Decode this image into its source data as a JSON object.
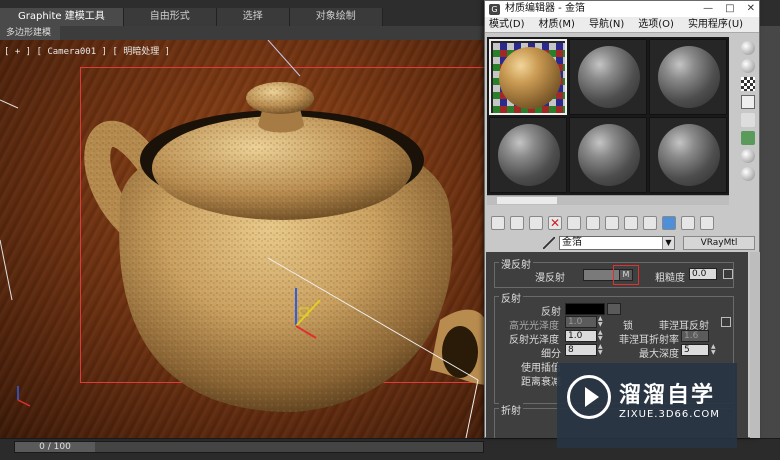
{
  "ribbon": {
    "tabs": [
      {
        "label": "Graphite 建模工具",
        "active": true
      },
      {
        "label": "自由形式",
        "active": false
      },
      {
        "label": "选择",
        "active": false
      },
      {
        "label": "对象绘制",
        "active": false
      }
    ],
    "sub_label": "多边形建模"
  },
  "viewport": {
    "label": "[ + ] [ Camera001 ] [ 明暗处理 ]"
  },
  "timeline": {
    "frame_label": "0 / 100"
  },
  "material_editor": {
    "title": "材质编辑器 - 金箔",
    "menu": [
      "模式(D)",
      "材质(M)",
      "导航(N)",
      "选项(O)",
      "实用程序(U)"
    ],
    "material_name": "金箔",
    "material_type": "VRayMtl",
    "diffuse": {
      "section": "漫反射",
      "diffuse_label": "漫反射",
      "map_button": "M",
      "roughness_label": "粗糙度",
      "roughness_value": "0.0"
    },
    "reflection": {
      "section": "反射",
      "reflect_label": "反射",
      "hilight_gloss_label": "高光光泽度",
      "hilight_gloss_value": "1.0",
      "lock_label": "锁",
      "fresnel_label": "菲涅耳反射",
      "refl_gloss_label": "反射光泽度",
      "refl_gloss_value": "1.0",
      "fresnel_ior_label": "菲涅耳折射率",
      "fresnel_ior_value": "1.6",
      "subdivs_label": "细分",
      "subdivs_value": "8",
      "max_depth_label": "最大深度",
      "max_depth_value": "5",
      "interp_label": "使用插值",
      "dim_distance_label": "距离衰减"
    },
    "refraction": {
      "section": "折射"
    },
    "colors": {
      "reflect_swatch": "#000000",
      "diffuse_swatch": "#7a7a7a",
      "accent": "#e03a3a"
    }
  },
  "watermark": {
    "title": "溜溜自学",
    "url": "ZIXUE.3D66.COM"
  }
}
